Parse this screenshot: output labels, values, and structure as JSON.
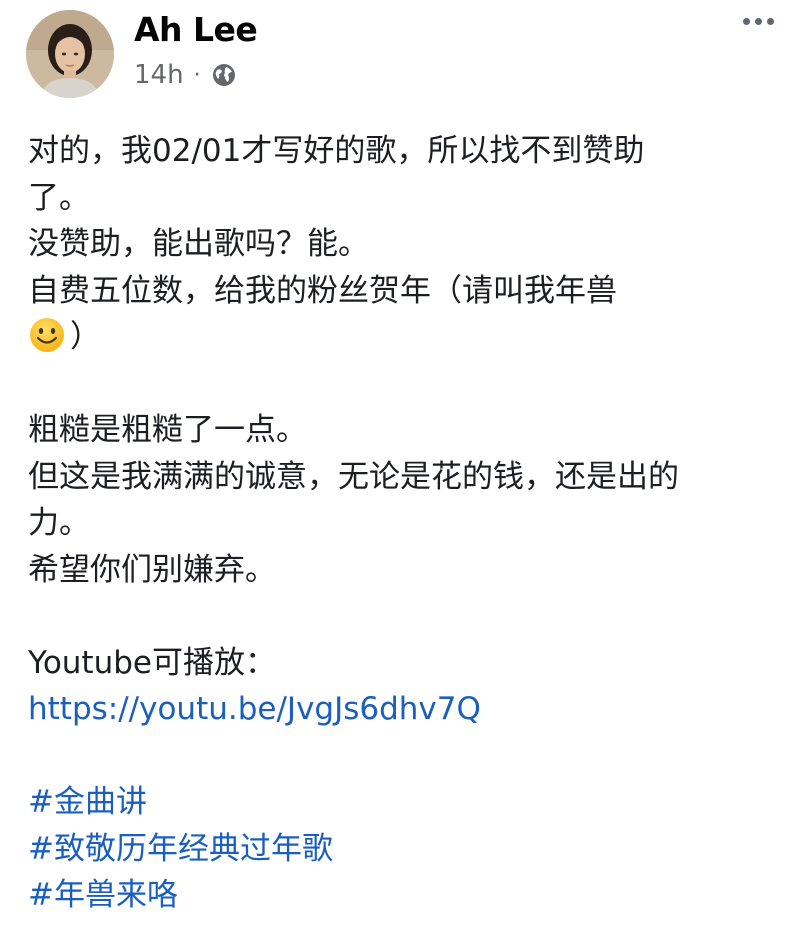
{
  "post": {
    "author": "Ah Lee",
    "time": "14h",
    "separator": "·",
    "privacy_icon": "globe-icon",
    "menu_icon": "more-options-icon",
    "avatar_icon": "profile-avatar",
    "lines": {
      "l1": "对的，我02/01才写好的歌，所以找不到赞助",
      "l2": "了。",
      "l3": "没赞助，能出歌吗？能。",
      "l4": "自费五位数，给我的粉丝贺年（请叫我年兽",
      "l5_emoji": "smiling-face-emoji",
      "l5_text": "）",
      "l6": "粗糙是粗糙了一点。",
      "l7": "但这是我满满的诚意，无论是花的钱，还是出的",
      "l8": "力。",
      "l9": "希望你们别嫌弃。",
      "l10": "Youtube可播放：",
      "link": "https://youtu.be/JvgJs6dhv7Q"
    },
    "hashtags": [
      "#金曲讲",
      "#致敬历年经典过年歌",
      "#年兽来咯"
    ],
    "colors": {
      "link": "#1a5fbf",
      "meta": "#65676b",
      "text": "#1c1e21"
    }
  }
}
